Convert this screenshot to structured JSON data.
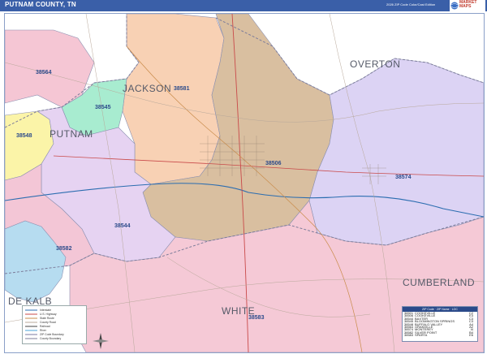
{
  "title": "PUTNAM COUNTY, TN",
  "edition": "2026 ZIP Code Color/Cast Edition",
  "logo": {
    "brand": "MARKET MAPS"
  },
  "counties": [
    {
      "name": "JACKSON"
    },
    {
      "name": "OVERTON"
    },
    {
      "name": "PUTNAM"
    },
    {
      "name": "DE KALB"
    },
    {
      "name": "WHITE"
    },
    {
      "name": "CUMBERLAND"
    }
  ],
  "zip_labels": [
    "38564",
    "38581",
    "38545",
    "38548",
    "38506",
    "38574",
    "38544",
    "38582",
    "38583"
  ],
  "zip_colors": {
    "38564": "#f5c6d4",
    "38581": "#f8d1b4",
    "38545": "#a8ecd0",
    "38548": "#fbf4a8",
    "38506": "#d9bfa0",
    "38574": "#dcd3f4",
    "38544": "#e6d3f2",
    "38582": "#f3c6d6",
    "38583": "#f5c9d6",
    "water": "#b6dcf0"
  },
  "legend": {
    "items": [
      "Interstate",
      "U.S. Highway",
      "State Route",
      "County Road",
      "Railroad",
      "River",
      "ZIP Code Boundary",
      "County Boundary"
    ]
  },
  "zip_table": {
    "header": [
      "ZIP Code",
      "ZIP Name",
      "LOC"
    ],
    "rows": [
      {
        "zip": "38501",
        "name": "COOKEVILLE",
        "grid": "C2"
      },
      {
        "zip": "38506",
        "name": "COOKEVILLE",
        "grid": "E3"
      },
      {
        "zip": "38544",
        "name": "BAXTER",
        "grid": "C3"
      },
      {
        "zip": "38545",
        "name": "BLOOMINGTON SPRINGS",
        "grid": "C3"
      },
      {
        "zip": "38548",
        "name": "BUFFALO VALLEY",
        "grid": "A4"
      },
      {
        "zip": "38564",
        "name": "GRANVILLE",
        "grid": "A2"
      },
      {
        "zip": "38574",
        "name": "MONTEREY",
        "grid": "I4"
      },
      {
        "zip": "38582",
        "name": "SILVER POINT",
        "grid": "B4"
      },
      {
        "zip": "38583",
        "name": "SPARTA",
        "grid": "E6"
      }
    ]
  }
}
